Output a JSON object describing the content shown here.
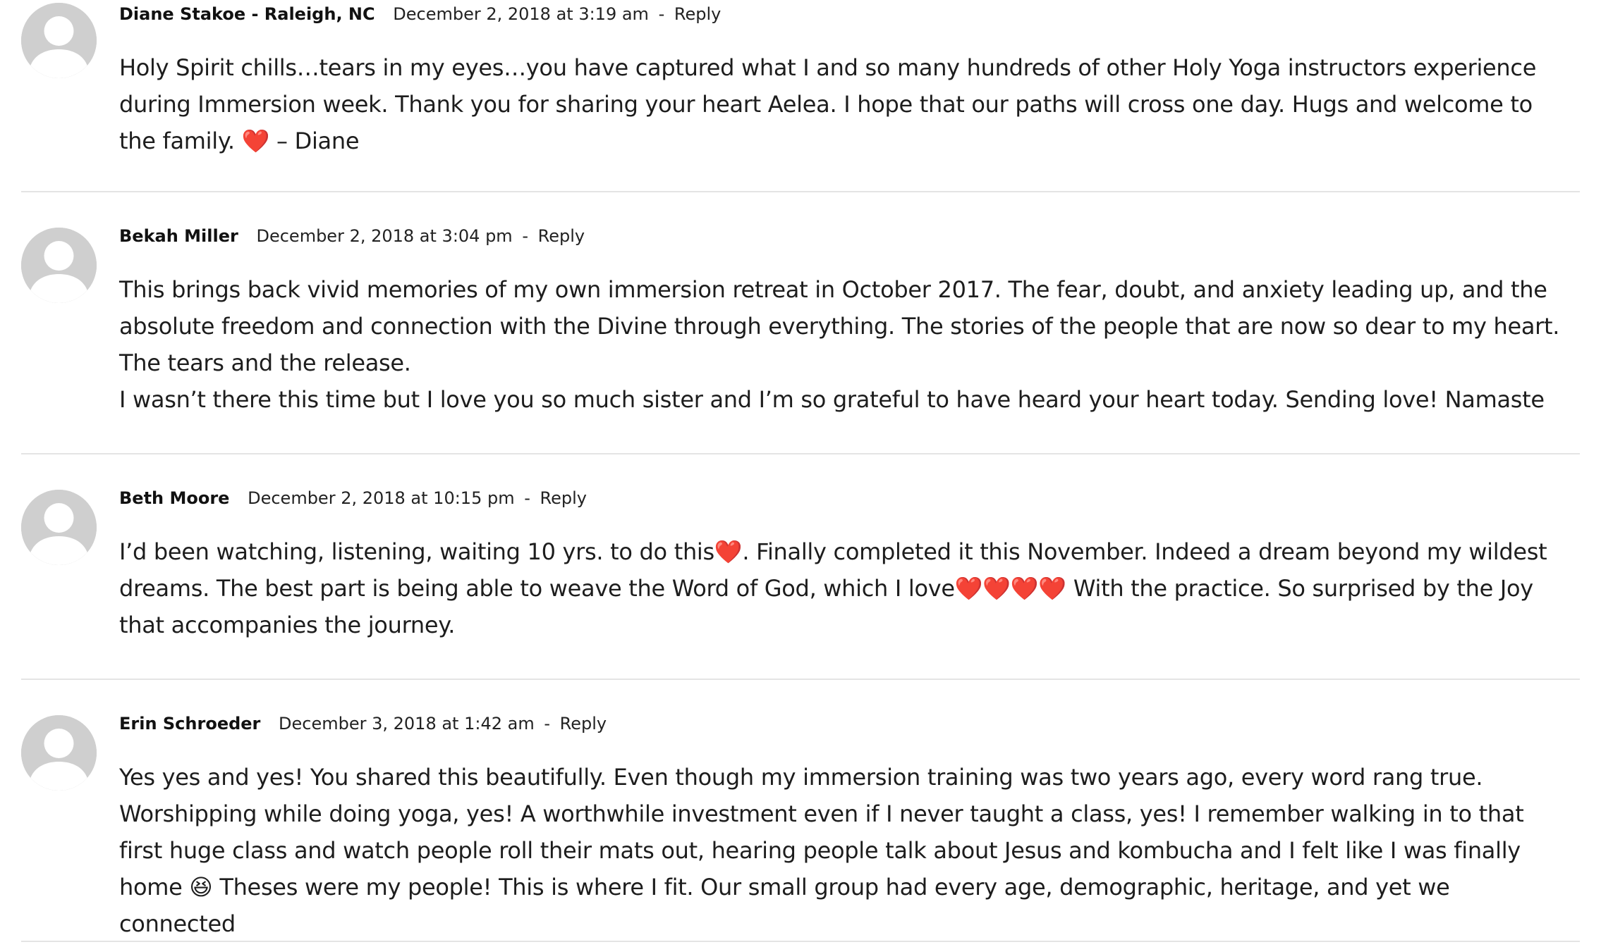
{
  "comments": [
    {
      "author": "Diane Stakoe - Raleigh, NC",
      "date": "December 2, 2018 at 3:19 am",
      "separator": "-",
      "reply_label": "Reply",
      "paragraphs": [
        "Holy Spirit chills…tears in my eyes…you have captured what I and so many hundreds of other Holy Yoga instructors experience during Immersion week. Thank you for sharing your heart Aelea. I hope that our paths will cross one day. Hugs and welcome to the family. ❤️ – Diane"
      ]
    },
    {
      "author": "Bekah Miller",
      "date": "December 2, 2018 at 3:04 pm",
      "separator": "-",
      "reply_label": "Reply",
      "paragraphs": [
        "This brings back vivid memories of my own immersion retreat in October 2017. The fear, doubt, and anxiety leading up, and the absolute freedom and connection with the Divine through everything. The stories of the people that are now so dear to my heart. The tears and the release.",
        "I wasn’t there this time but I love you so much sister and I’m so grateful to have heard your heart today. Sending love! Namaste"
      ]
    },
    {
      "author": "Beth Moore",
      "date": "December 2, 2018 at 10:15 pm",
      "separator": "-",
      "reply_label": "Reply",
      "paragraphs": [
        "I’d been watching, listening, waiting 10 yrs. to do this❤️. Finally completed it this November. Indeed a dream beyond my wildest dreams. The best part is being able to weave the Word of God, which I love❤️❤️❤️❤️ With the practice. So surprised by the Joy that accompanies the journey."
      ]
    },
    {
      "author": "Erin Schroeder",
      "date": "December 3, 2018 at 1:42 am",
      "separator": "-",
      "reply_label": "Reply",
      "paragraphs": [
        "Yes yes and yes! You shared this beautifully. Even though my immersion training was two years ago, every word rang true. Worshipping while doing yoga, yes! A worthwhile investment even if I never taught a class, yes! I remember walking in to that first huge class and watch people roll their mats out, hearing people talk about Jesus and kombucha and I felt like I was finally home 😆 Theses were my people! This is where I fit. Our small group had every age, demographic, heritage, and yet we connected"
      ]
    }
  ],
  "colors": {
    "avatar_bg": "#cfcfcf",
    "avatar_fg": "#ffffff",
    "divider": "#e4e4e4",
    "heart": "#e0191f"
  },
  "icons": {
    "avatar": "default-user-avatar-icon",
    "heart": "red-heart-emoji-icon",
    "laugh": "grinning-squinting-face-emoji-icon"
  }
}
